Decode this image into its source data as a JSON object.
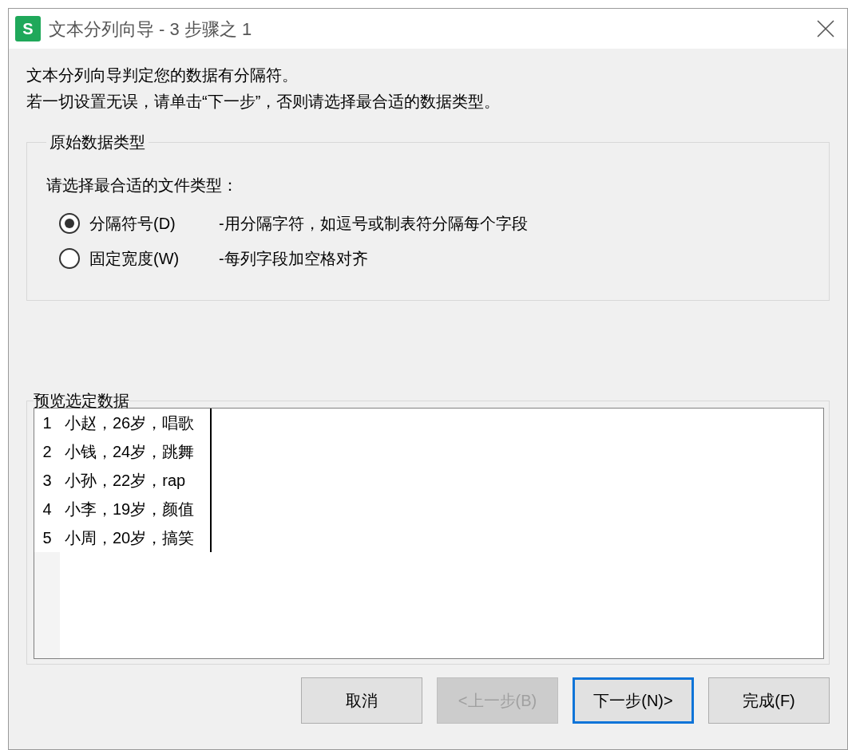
{
  "window": {
    "app_icon": "S",
    "title": "文本分列向导 - 3 步骤之 1"
  },
  "intro": [
    "文本分列向导判定您的数据有分隔符。",
    "若一切设置无误，请单击“下一步”，否则请选择最合适的数据类型。"
  ],
  "group": {
    "title": "原始数据类型",
    "prompt": "请选择最合适的文件类型：",
    "options": [
      {
        "label": "分隔符号(D)",
        "description": "-用分隔字符，如逗号或制表符分隔每个字段",
        "selected": true
      },
      {
        "label": "固定宽度(W)",
        "description": "-每列字段加空格对齐",
        "selected": false
      }
    ]
  },
  "preview": {
    "title": "预览选定数据",
    "rows": [
      {
        "number": "1",
        "text": "小赵，26岁，唱歌"
      },
      {
        "number": "2",
        "text": "小钱，24岁，跳舞"
      },
      {
        "number": "3",
        "text": "小孙，22岁，rap"
      },
      {
        "number": "4",
        "text": "小李，19岁，颜值"
      },
      {
        "number": "5",
        "text": "小周，20岁，搞笑"
      }
    ]
  },
  "buttons": [
    {
      "label": "取消",
      "disabled": false,
      "focused": false
    },
    {
      "label": "<上一步(B)",
      "disabled": true,
      "focused": false
    },
    {
      "label": "下一步(N)>",
      "disabled": false,
      "focused": true
    },
    {
      "label": "完成(F)",
      "disabled": false,
      "focused": false
    }
  ]
}
